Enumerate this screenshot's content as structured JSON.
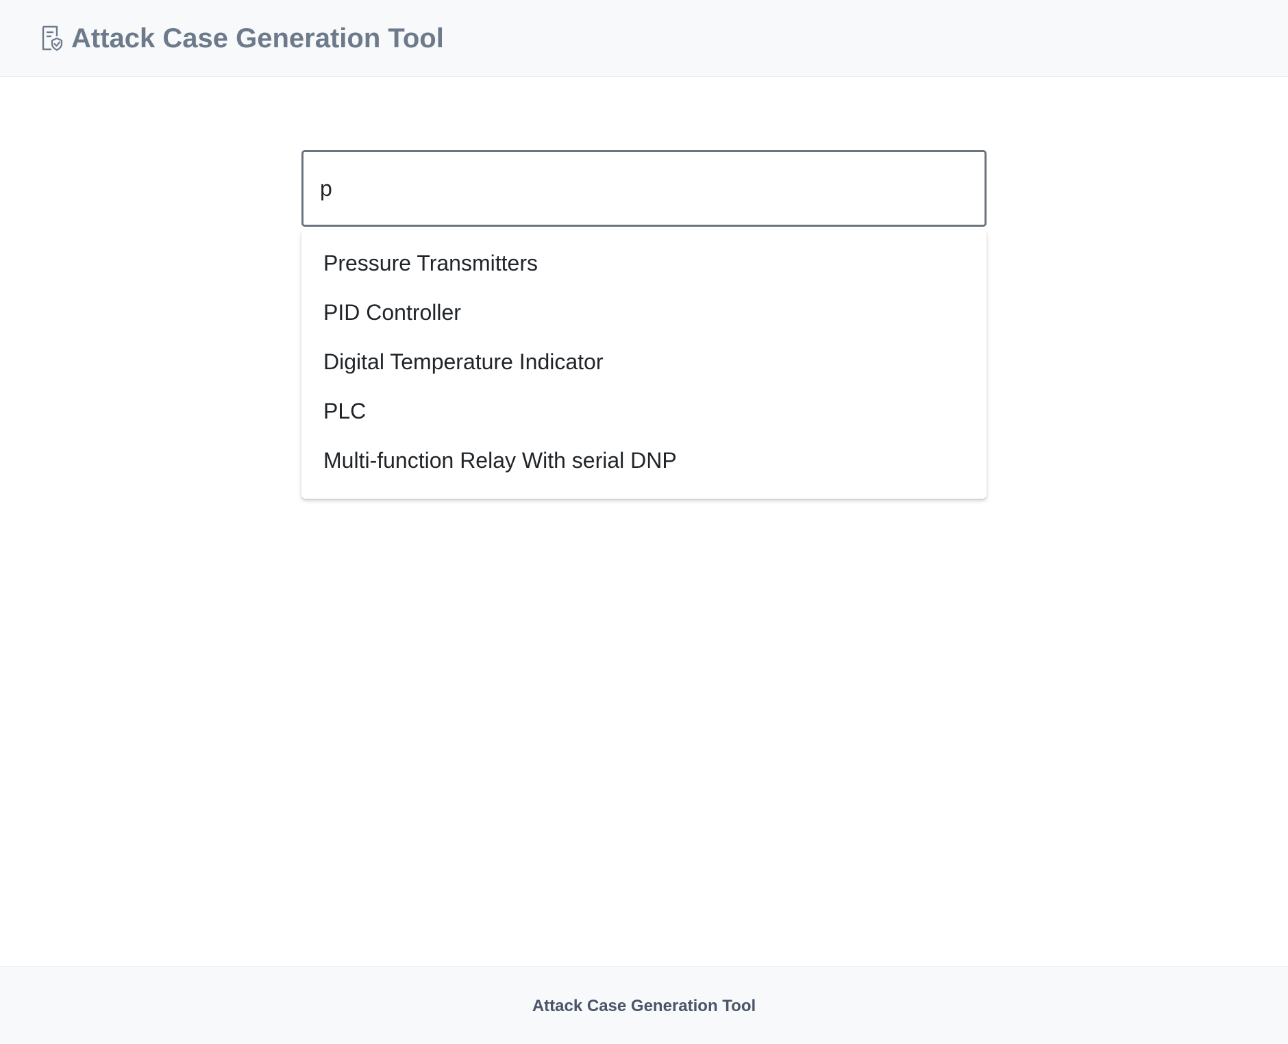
{
  "header": {
    "title": "Attack Case Generation Tool",
    "icon": "document-shield-icon"
  },
  "search": {
    "value": "p",
    "placeholder": ""
  },
  "suggestions": [
    "Pressure Transmitters",
    "PID Controller",
    "Digital Temperature Indicator",
    "PLC",
    "Multi-function Relay With serial DNP"
  ],
  "footer": {
    "text": "Attack Case Generation Tool"
  },
  "colors": {
    "header_bg": "#f8f9fa",
    "brand_text": "#6c7a8b",
    "input_border": "#6c757d",
    "footer_text": "#4a5568"
  }
}
